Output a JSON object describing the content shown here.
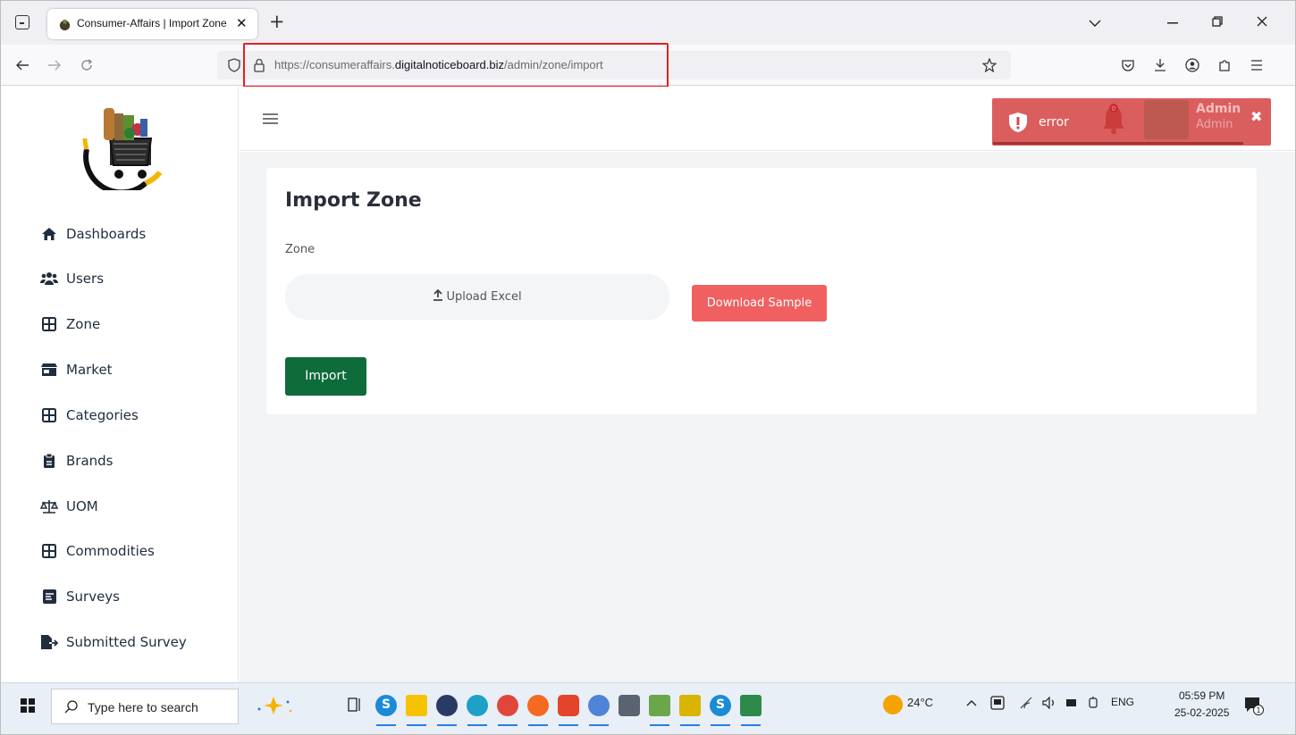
{
  "browser": {
    "tab_title": "Consumer-Affairs | Import Zone",
    "tab_close": "✕",
    "new_tab": "+",
    "url_prefix": "https://consumeraffairs.",
    "url_host": "digitalnoticeboard.biz",
    "url_path": "/admin/zone/import"
  },
  "sidebar": {
    "items": [
      {
        "label": "Dashboards",
        "icon": "home-icon"
      },
      {
        "label": "Users",
        "icon": "users-icon"
      },
      {
        "label": "Zone",
        "icon": "grid-icon"
      },
      {
        "label": "Market",
        "icon": "store-icon"
      },
      {
        "label": "Categories",
        "icon": "grid-icon"
      },
      {
        "label": "Brands",
        "icon": "clipboard-icon"
      },
      {
        "label": "UOM",
        "icon": "scale-icon"
      },
      {
        "label": "Commodities",
        "icon": "grid-icon"
      },
      {
        "label": "Surveys",
        "icon": "survey-icon"
      },
      {
        "label": "Submitted Survey",
        "icon": "file-export-icon"
      }
    ]
  },
  "header": {
    "notification_count": "0",
    "admin_name": "Admin",
    "admin_role": "Admin"
  },
  "toast": {
    "message": "error",
    "close": "✖",
    "color": "#d64848"
  },
  "main": {
    "title": "Import Zone",
    "field_label": "Zone",
    "upload_label": "Upload Excel",
    "download_label": "Download Sample",
    "import_label": "Import",
    "colors": {
      "download": "#f06060",
      "import": "#0e6b3a"
    }
  },
  "taskbar": {
    "search_placeholder": "Type here to search",
    "weather": "24°C",
    "language": "ENG",
    "time": "05:59 PM",
    "date": "25-02-2025",
    "notification_badge": "1"
  }
}
